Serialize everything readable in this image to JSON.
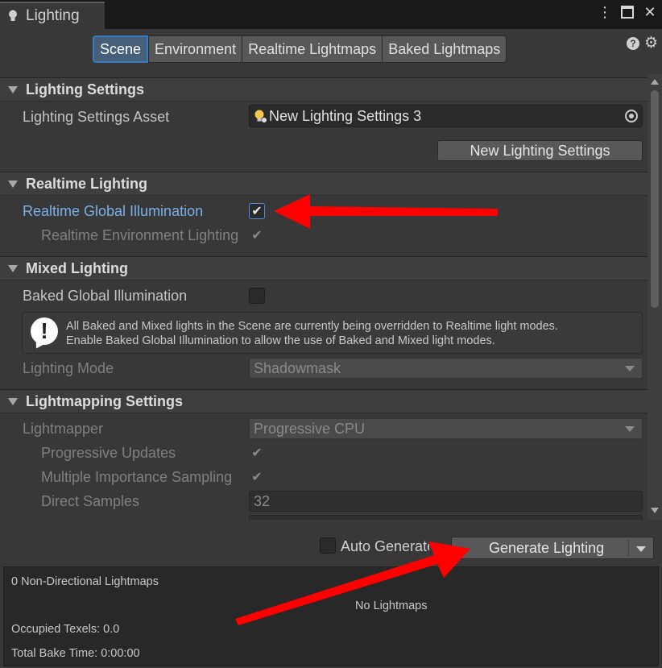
{
  "window": {
    "tab_title": "Lighting",
    "icons": {
      "tab": "lightbulb-icon",
      "menu": "more-vertical-icon",
      "maximize": "maximize-icon",
      "close": "close-icon",
      "help": "help-icon",
      "settings": "gear-icon"
    }
  },
  "toolbar": {
    "tabs": [
      {
        "label": "Scene",
        "active": true
      },
      {
        "label": "Environment",
        "active": false
      },
      {
        "label": "Realtime Lightmaps",
        "active": false
      },
      {
        "label": "Baked Lightmaps",
        "active": false
      }
    ]
  },
  "sections": {
    "lighting_settings": {
      "title": "Lighting Settings",
      "asset_label": "Lighting Settings Asset",
      "asset_value": "New Lighting Settings 3",
      "new_button": "New Lighting Settings"
    },
    "realtime_lighting": {
      "title": "Realtime Lighting",
      "realtime_gi_label": "Realtime Global Illumination",
      "realtime_gi_checked": true,
      "realtime_env_label": "Realtime Environment Lighting",
      "realtime_env_checked": true
    },
    "mixed_lighting": {
      "title": "Mixed Lighting",
      "baked_gi_label": "Baked Global Illumination",
      "baked_gi_checked": false,
      "help_line1": "All Baked and Mixed lights in the Scene are currently being overridden to Realtime light modes.",
      "help_line2": "Enable Baked Global Illumination to allow the use of Baked and Mixed light modes.",
      "lighting_mode_label": "Lighting Mode",
      "lighting_mode_value": "Shadowmask"
    },
    "lightmapping_settings": {
      "title": "Lightmapping Settings",
      "lightmapper_label": "Lightmapper",
      "lightmapper_value": "Progressive CPU",
      "progressive_updates_label": "Progressive Updates",
      "progressive_updates_checked": true,
      "mis_label": "Multiple Importance Sampling",
      "mis_checked": true,
      "direct_samples_label": "Direct Samples",
      "direct_samples_value": "32"
    }
  },
  "bottom": {
    "auto_generate_label": "Auto Generate",
    "auto_generate_checked": false,
    "generate_button": "Generate Lighting"
  },
  "stats": {
    "lightmaps": "0 Non-Directional Lightmaps",
    "no_lightmaps": "No Lightmaps",
    "occupied_texels": "Occupied Texels: 0.0",
    "bake_time": "Total Bake Time: 0:00:00"
  },
  "colors": {
    "annotation_arrow": "#ff0000",
    "active_tab": "#46607c",
    "link_label": "#7bafe8"
  }
}
